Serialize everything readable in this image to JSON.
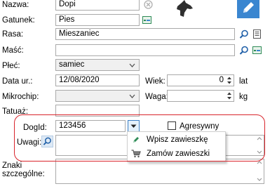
{
  "fields": {
    "nazwa": {
      "label": "Nazwa:",
      "value": "Dopi"
    },
    "gatunek": {
      "label": "Gatunek:",
      "value": "Pies"
    },
    "rasa": {
      "label": "Rasa:",
      "value": "Mieszaniec"
    },
    "masc": {
      "label": "Maść:",
      "value": ""
    },
    "plec": {
      "label": "Płeć:",
      "value": "samiec"
    },
    "data_ur": {
      "label": "Data ur.:",
      "value": "12/08/2020"
    },
    "wiek": {
      "label": "Wiek:",
      "value": "0",
      "unit": "lat"
    },
    "mikrochip": {
      "label": "Mikrochip:",
      "value": ""
    },
    "waga": {
      "label": "Waga:",
      "value": "",
      "unit": "kg"
    },
    "tatuaz": {
      "label": "Tatuaż:",
      "value": ""
    },
    "dogid": {
      "label": "DogId:",
      "value": "123456"
    },
    "agresywny": {
      "label": "Agresywny",
      "checked": false
    },
    "uwagi": {
      "label": "Uwagi:",
      "value": ""
    },
    "znaki": {
      "label_line1": "Znaki",
      "label_line2": "szczególne:",
      "value": ""
    }
  },
  "dogid_menu": {
    "items": [
      {
        "label": "Wpisz zawieszkę",
        "icon": "pencil-icon"
      },
      {
        "label": "Zamów zawieszki",
        "icon": "cart-icon"
      }
    ]
  },
  "colors": {
    "highlight": "#d9242b",
    "accent": "#3a86d0",
    "green_icon": "#2e8b57"
  }
}
